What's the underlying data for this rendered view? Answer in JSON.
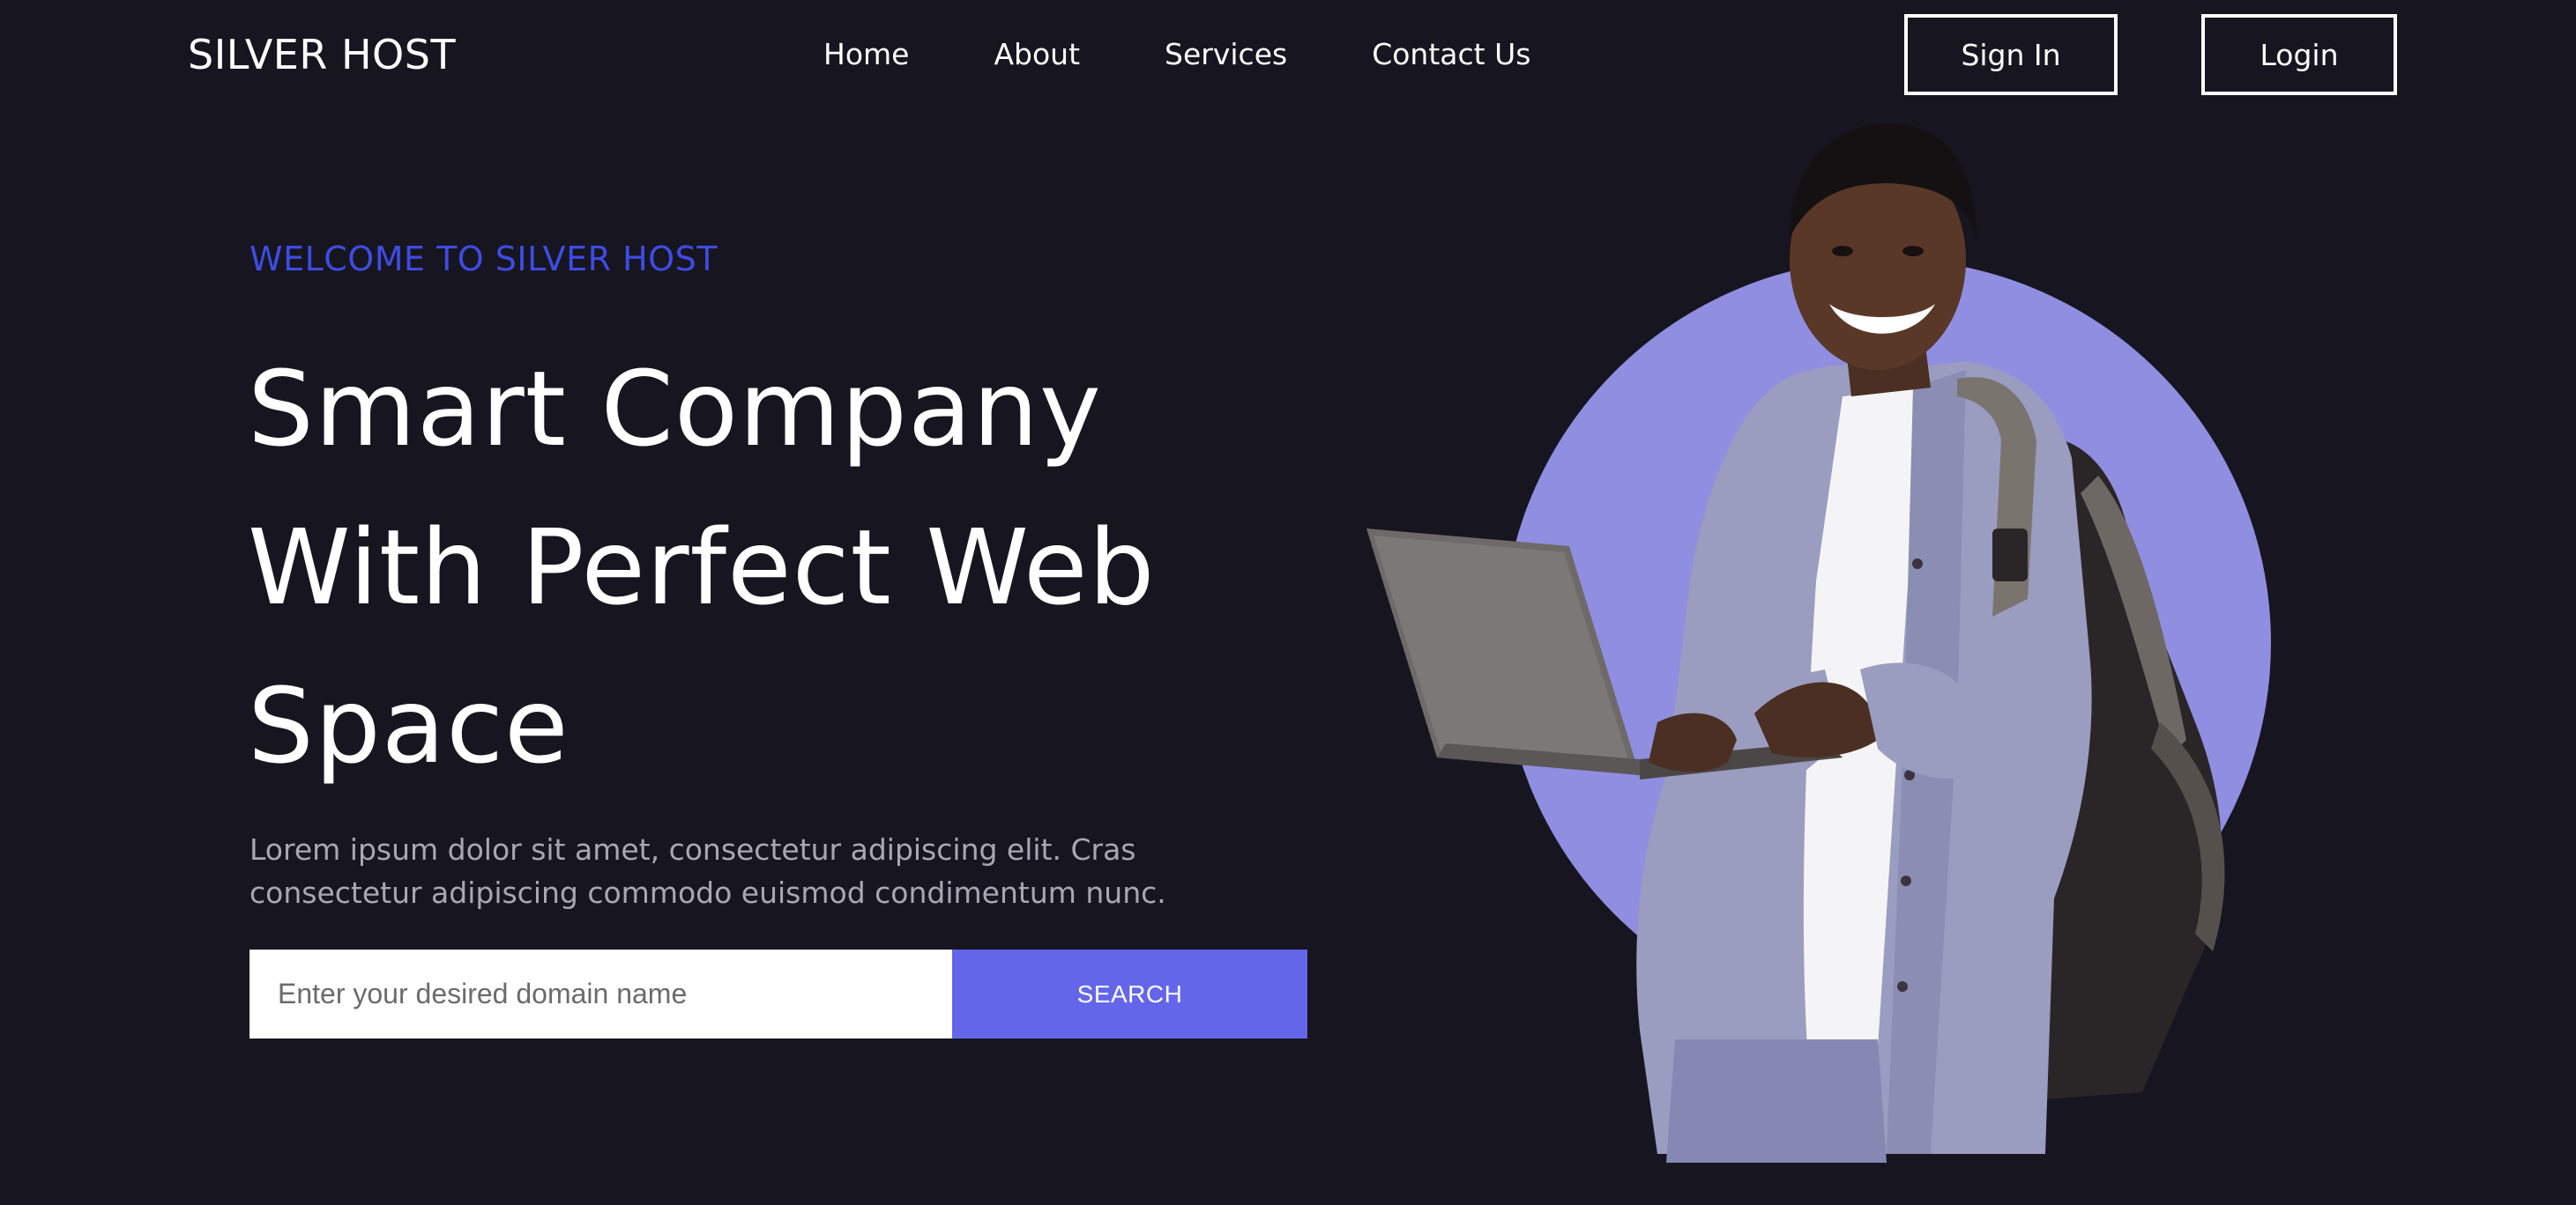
{
  "navbar": {
    "brand": "SILVER HOST",
    "links": [
      {
        "label": "Home"
      },
      {
        "label": "About"
      },
      {
        "label": "Services"
      },
      {
        "label": "Contact Us"
      }
    ],
    "sign_in_label": "Sign In",
    "login_label": "Login"
  },
  "hero": {
    "eyebrow": "WELCOME TO SILVER HOST",
    "headline_lines": [
      "Smart Company",
      "With Perfect Web",
      "Space"
    ],
    "lead": "Lorem ipsum dolor sit amet, consectetur adipiscing elit. Cras consectetur adipiscing commodo euismod condimentum nunc.",
    "search": {
      "placeholder": "Enter your desired domain name",
      "value": "",
      "button_label": "SEARCH"
    },
    "image": {
      "subject": "smiling-man-with-laptop-and-backpack",
      "circle_color": "#8f8ee0"
    }
  },
  "colors": {
    "background": "#171520",
    "accent": "#6366e9",
    "eyebrow": "#3d4ce3",
    "muted_text": "#a9a7b4"
  }
}
